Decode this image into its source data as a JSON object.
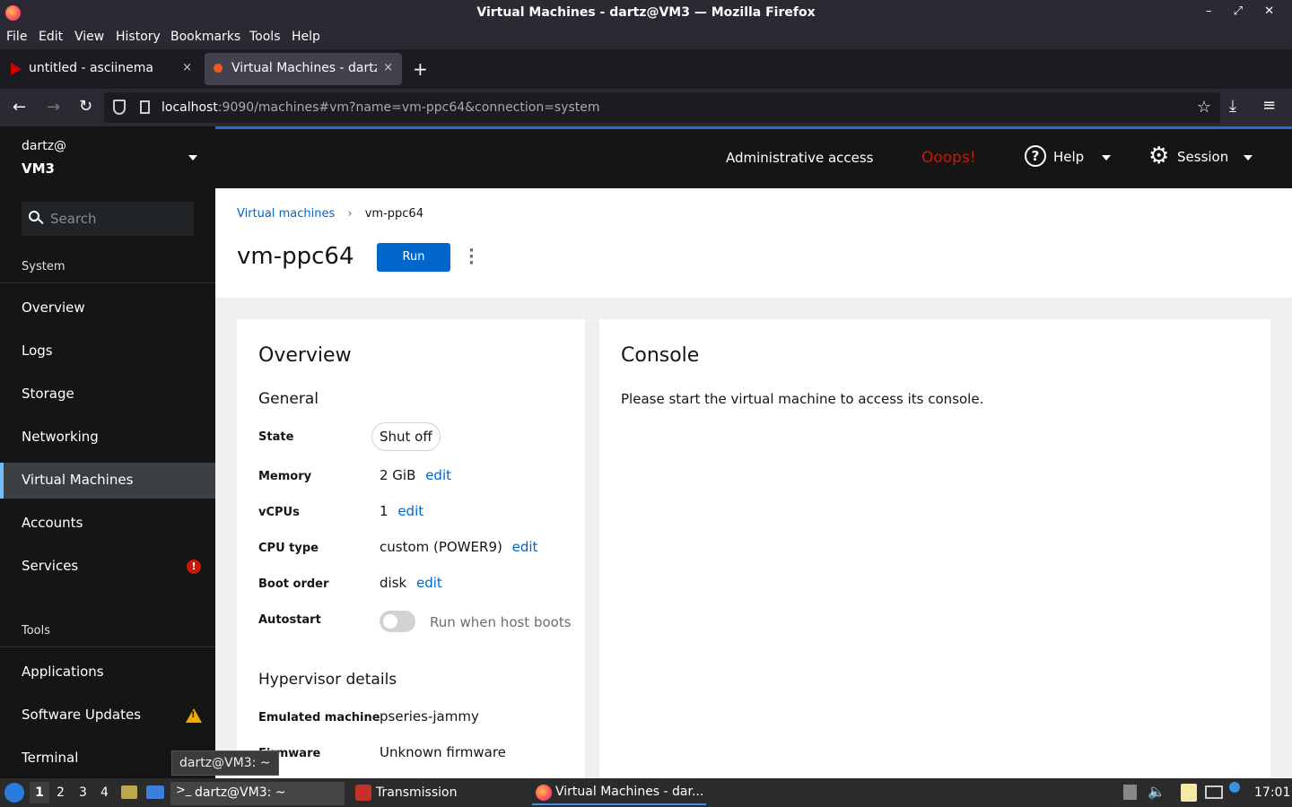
{
  "window": {
    "title": "Virtual Machines - dartz@VM3 — Mozilla Firefox",
    "controls": "– ⤢ ✕"
  },
  "menubar": [
    "File",
    "Edit",
    "View",
    "History",
    "Bookmarks",
    "Tools",
    "Help"
  ],
  "tabs": [
    {
      "label": "untitled - asciinema",
      "close": "×"
    },
    {
      "label": "Virtual Machines - dartz@",
      "close": "×"
    }
  ],
  "newtab": "+",
  "url": {
    "host": "localhost",
    "rest": ":9090/machines#vm?name=vm-ppc64&connection=system"
  },
  "host": {
    "user": "dartz@",
    "name": "VM3"
  },
  "search": {
    "placeholder": "Search"
  },
  "sidebar": {
    "system_label": "System",
    "system_items": [
      {
        "label": "Overview"
      },
      {
        "label": "Logs"
      },
      {
        "label": "Storage"
      },
      {
        "label": "Networking"
      },
      {
        "label": "Virtual Machines",
        "active": true
      },
      {
        "label": "Accounts"
      },
      {
        "label": "Services",
        "badge": "!"
      }
    ],
    "tools_label": "Tools",
    "tool_items": [
      {
        "label": "Applications"
      },
      {
        "label": "Software Updates",
        "badge": "!"
      },
      {
        "label": "Terminal"
      }
    ]
  },
  "masthead": {
    "admin": "Administrative access",
    "ooops": "Ooops!",
    "help": "Help",
    "session": "Session"
  },
  "breadcrumb": {
    "parent": "Virtual machines",
    "current": "vm-ppc64"
  },
  "page": {
    "title": "vm-ppc64",
    "run": "Run"
  },
  "overview": {
    "title": "Overview",
    "general": "General",
    "state_label": "State",
    "state_value": "Shut off",
    "memory_label": "Memory",
    "memory_value": "2 GiB",
    "vcpus_label": "vCPUs",
    "vcpus_value": "1",
    "cputype_label": "CPU type",
    "cputype_value": "custom (POWER9)",
    "boot_label": "Boot order",
    "boot_value": "disk",
    "autostart_label": "Autostart",
    "autostart_value": "Run when host boots",
    "edit": "edit",
    "hypervisor": "Hypervisor details",
    "emulated_label": "Emulated machine",
    "emulated_value": "pseries-jammy",
    "firmware_label": "Firmware",
    "firmware_value": "Unknown firmware"
  },
  "console": {
    "title": "Console",
    "message": "Please start the virtual machine to access its console."
  },
  "tooltip": "dartz@VM3: ~",
  "taskbar": {
    "workspaces": [
      "1",
      "2",
      "3",
      "4"
    ],
    "apps": [
      {
        "label": "dartz@VM3: ~"
      },
      {
        "label": "Transmission"
      },
      {
        "label": "Virtual Machines - dar..."
      }
    ],
    "clock": "17:01"
  },
  "colors": {
    "accent": "#0066cc",
    "run_button": "#0066cc",
    "ooops": "#c9190b",
    "warning": "#f0ab00"
  }
}
